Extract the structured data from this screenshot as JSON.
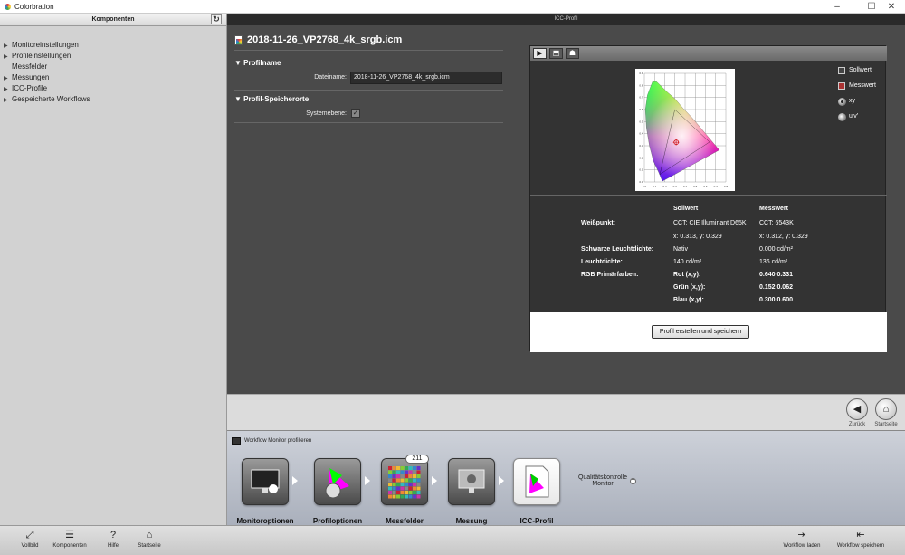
{
  "window": {
    "title": "Colorbration",
    "minimize": "–",
    "maximize": "☐",
    "close": "✕"
  },
  "sidebar": {
    "header": "Komponenten",
    "refresh_icon": "↻",
    "items": [
      {
        "label": "Monitoreinstellungen",
        "arrow": "▶"
      },
      {
        "label": "Profileinstellungen",
        "arrow": "▶"
      },
      {
        "label": "Messfelder",
        "arrow": ""
      },
      {
        "label": "Messungen",
        "arrow": "▶"
      },
      {
        "label": "ICC-Profile",
        "arrow": "▶"
      },
      {
        "label": "Gespeicherte Workflows",
        "arrow": "▶"
      }
    ]
  },
  "main": {
    "header": "ICC-Profil",
    "filename": "2018-11-26_VP2768_4k_srgb.icm",
    "section1": {
      "title": "Profilname",
      "arrow": "▼",
      "field_label": "Dateiname:",
      "field_value": "2018-11-26_VP2768_4k_srgb.icm"
    },
    "section2": {
      "title": "Profil-Speicherorte",
      "arrow": "▼",
      "field_label": "Systemebene:",
      "checked": "✓"
    }
  },
  "panel": {
    "toolbar": {
      "btn1": "▶",
      "btn2": "⬒",
      "btn3": "☗"
    },
    "legend": {
      "sollwert": "Sollwert",
      "messwert": "Messwert",
      "xy": "xy",
      "uv": "u'v'"
    },
    "columns": {
      "sollwert": "Sollwert",
      "messwert": "Messwert"
    },
    "rows": {
      "weisspunkt_label": "Weißpunkt:",
      "weisspunkt_soll1": "CCT: CIE Illuminant D65K",
      "weisspunkt_soll2": "x: 0.313, y: 0.329",
      "weisspunkt_mess1": "CCT: 6543K",
      "weisspunkt_mess2": "x: 0.312, y: 0.329",
      "schwarz_label": "Schwarze Leuchtdichte:",
      "schwarz_soll": "Nativ",
      "schwarz_mess": "0.000 cd/m²",
      "leucht_label": "Leuchtdichte:",
      "leucht_soll": "140 cd/m²",
      "leucht_mess": "136 cd/m²",
      "rgb_label": "RGB Primärfarben:",
      "rot_label": "Rot (x,y):",
      "rot_val": "0.640,0.331",
      "gruen_label": "Grün (x,y):",
      "gruen_val": "0.152,0.062",
      "blau_label": "Blau (x,y):",
      "blau_val": "0.300,0.600"
    },
    "button": "Profil erstellen und speichern"
  },
  "nav": {
    "back_label": "Zurück",
    "back_icon": "◀",
    "home_label": "Startseite",
    "home_icon": "⌂"
  },
  "workflow": {
    "title": "Workflow Monitor profilieren",
    "steps": [
      {
        "label": "Monitoroptionen"
      },
      {
        "label": "Profiloptionen"
      },
      {
        "label": "Messfelder",
        "badge": "211"
      },
      {
        "label": "Messung"
      },
      {
        "label": "ICC-Profil"
      }
    ],
    "quality": "Qualitätskontrolle Monitor",
    "quality_plus": "+"
  },
  "bottombar": {
    "vollbild": "Vollbild",
    "vollbild_icon": "⤢",
    "komponenten": "Komponenten",
    "komponenten_icon": "☰",
    "hilfe": "Hilfe",
    "hilfe_icon": "?",
    "startseite": "Startseite",
    "startseite_icon": "⌂",
    "workflow_laden": "Workflow laden",
    "workflow_laden_icon": "⇥",
    "workflow_speichern": "Workflow speichern",
    "workflow_speichern_icon": "⇤"
  },
  "chart_data": {
    "type": "scatter",
    "xlim": [
      0,
      0.8
    ],
    "ylim": [
      0,
      0.9
    ],
    "x_ticks": [
      "0.0",
      "0.1",
      "0.2",
      "0.3",
      "0.4",
      "0.5",
      "0.6",
      "0.7",
      "0.8"
    ],
    "y_ticks": [
      "0.0",
      "0.1",
      "0.2",
      "0.3",
      "0.4",
      "0.5",
      "0.6",
      "0.7",
      "0.8",
      "0.9"
    ],
    "grid": true,
    "gamut": [
      [
        0.64,
        0.331
      ],
      [
        0.3,
        0.6
      ],
      [
        0.152,
        0.062
      ]
    ],
    "white_point_target": [
      0.313,
      0.329
    ],
    "white_point_measured": [
      0.312,
      0.329
    ],
    "colors": {
      "grid": "#888888",
      "marker": "#cc0000",
      "axis": "#cccccc"
    }
  }
}
